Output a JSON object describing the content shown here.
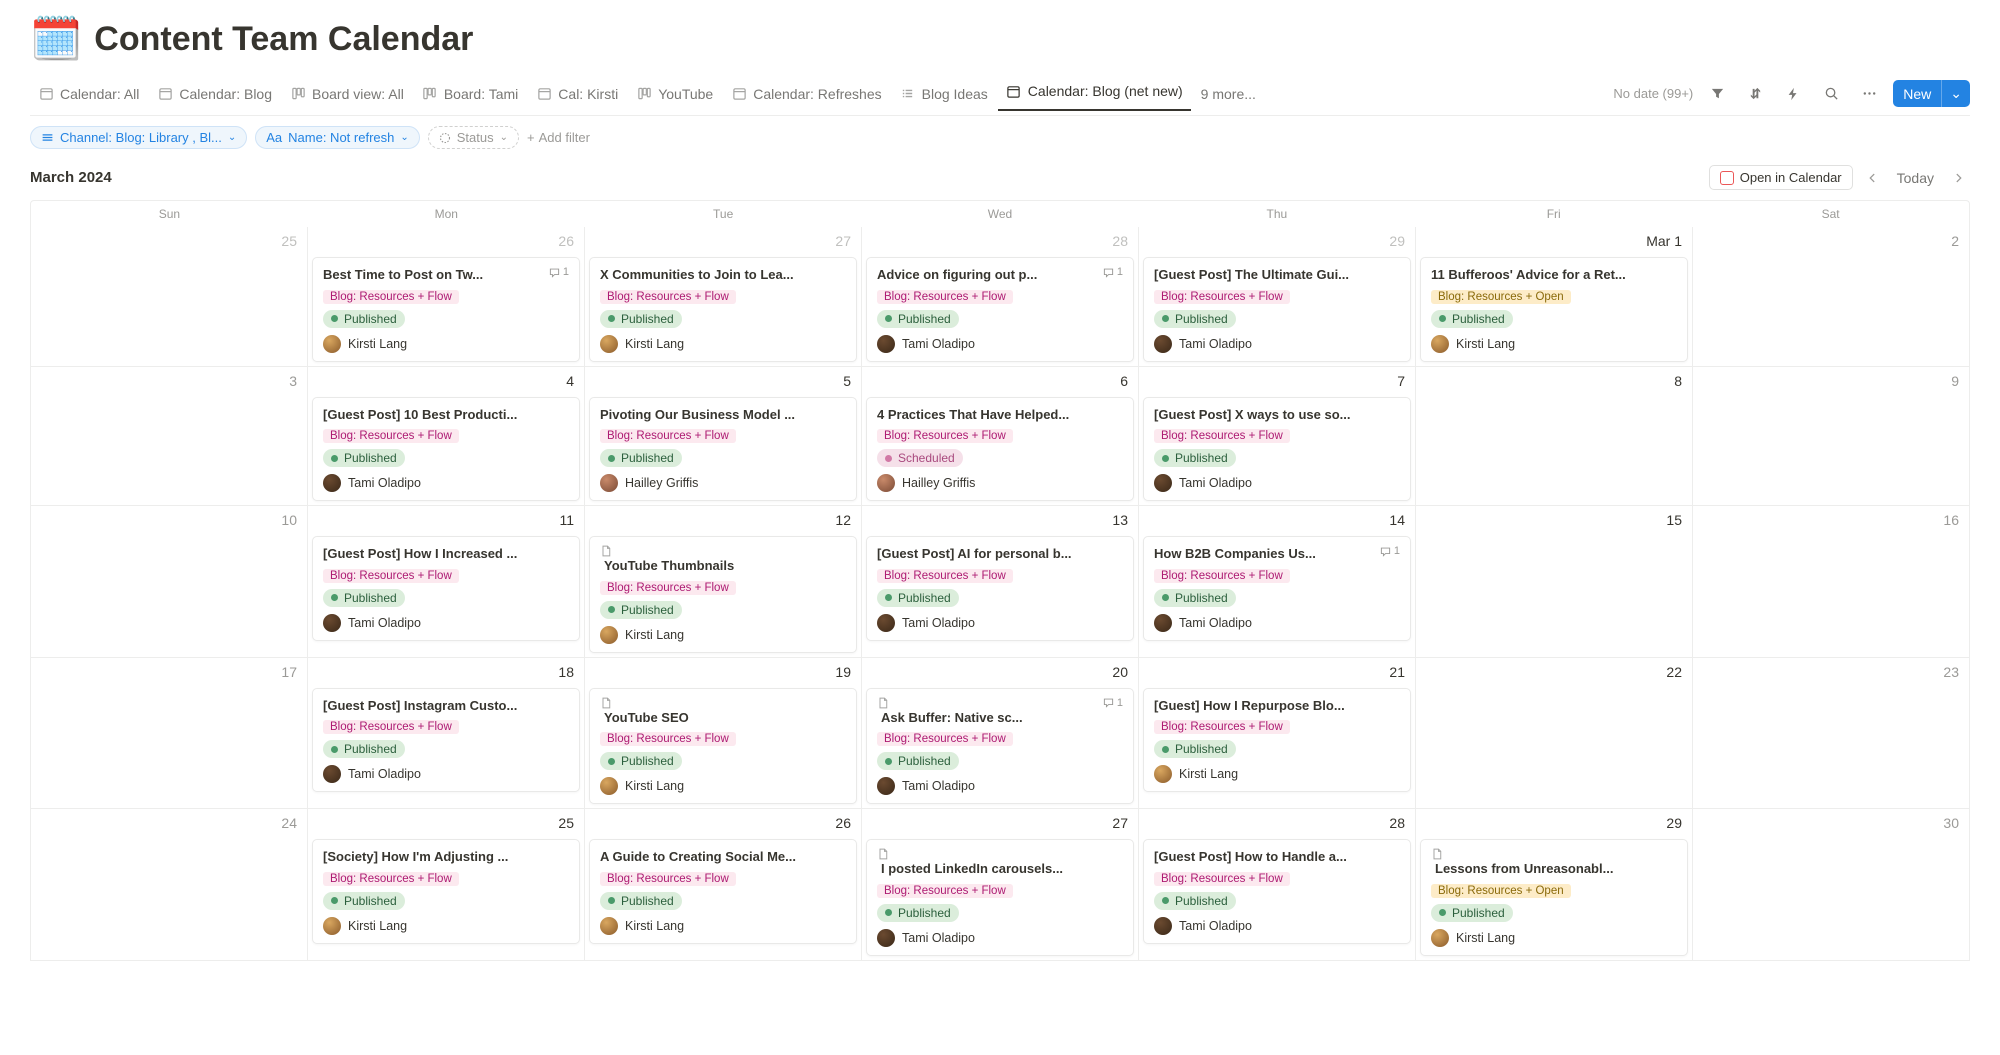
{
  "header": {
    "icon": "📅",
    "title": "Content Team Calendar"
  },
  "tabs": [
    {
      "label": "Calendar: All",
      "icon": "calendar"
    },
    {
      "label": "Calendar: Blog",
      "icon": "calendar"
    },
    {
      "label": "Board view: All",
      "icon": "board"
    },
    {
      "label": "Board: Tami",
      "icon": "board"
    },
    {
      "label": "Cal: Kirsti",
      "icon": "calendar"
    },
    {
      "label": "YouTube",
      "icon": "board"
    },
    {
      "label": "Calendar: Refreshes",
      "icon": "calendar"
    },
    {
      "label": "Blog Ideas",
      "icon": "list"
    },
    {
      "label": "Calendar: Blog (net new)",
      "icon": "calendar",
      "active": true
    }
  ],
  "more_tabs": "9 more...",
  "no_date": "No date (99+)",
  "new_label": "New",
  "filters": {
    "f1": "Channel: Blog: Library , Bl...",
    "f2": "Name: Not refresh",
    "f2_prefix": "Aa",
    "f3": "Status",
    "add": "Add filter"
  },
  "month": "March 2024",
  "open_cal": "Open in Calendar",
  "today": "Today",
  "dow": [
    "Sun",
    "Mon",
    "Tue",
    "Wed",
    "Thu",
    "Fri",
    "Sat"
  ],
  "tags": {
    "flow": "Blog: Resources + Flow",
    "open": "Blog: Resources + Open"
  },
  "statuses": {
    "published": "Published",
    "scheduled": "Scheduled"
  },
  "authors": {
    "kirsti": {
      "name": "Kirsti Lang",
      "color1": "#d9a760",
      "color2": "#8a5a2a"
    },
    "tami": {
      "name": "Tami Oladipo",
      "color1": "#6b4a30",
      "color2": "#3a2818"
    },
    "hailley": {
      "name": "Hailley Griffis",
      "color1": "#c98a6a",
      "color2": "#7a4a35"
    }
  },
  "weeks": [
    {
      "days": [
        {
          "num": "25",
          "outside": true
        },
        {
          "num": "26",
          "outside": true,
          "cards": [
            {
              "title": "Best Time to Post on Tw...",
              "tag": "flow",
              "status": "published",
              "author": "kirsti",
              "comments": "1"
            }
          ]
        },
        {
          "num": "27",
          "outside": true,
          "cards": [
            {
              "title": "X Communities to Join to Lea...",
              "tag": "flow",
              "status": "published",
              "author": "kirsti"
            }
          ]
        },
        {
          "num": "28",
          "outside": true,
          "cards": [
            {
              "title": "Advice on figuring out p...",
              "tag": "flow",
              "status": "published",
              "author": "tami",
              "comments": "1"
            }
          ]
        },
        {
          "num": "29",
          "outside": true,
          "cards": [
            {
              "title": "[Guest Post] The Ultimate Gui...",
              "tag": "flow",
              "status": "published",
              "author": "tami"
            }
          ]
        },
        {
          "num": "Mar 1",
          "first": true,
          "cards": [
            {
              "title": "11 Bufferoos' Advice for a Ret...",
              "tag": "open",
              "status": "published",
              "author": "kirsti"
            }
          ]
        },
        {
          "num": "2"
        }
      ]
    },
    {
      "days": [
        {
          "num": "3"
        },
        {
          "num": "4",
          "cards": [
            {
              "title": "[Guest Post] 10 Best Producti...",
              "tag": "flow",
              "status": "published",
              "author": "tami"
            }
          ]
        },
        {
          "num": "5",
          "cards": [
            {
              "title": "Pivoting Our Business Model ...",
              "tag": "flow",
              "status": "published",
              "author": "hailley"
            }
          ]
        },
        {
          "num": "6",
          "cards": [
            {
              "title": "4 Practices That Have Helped...",
              "tag": "flow",
              "status": "scheduled",
              "author": "hailley"
            }
          ]
        },
        {
          "num": "7",
          "cards": [
            {
              "title": "[Guest Post] X ways to use so...",
              "tag": "flow",
              "status": "published",
              "author": "tami"
            }
          ]
        },
        {
          "num": "8"
        },
        {
          "num": "9"
        }
      ]
    },
    {
      "days": [
        {
          "num": "10"
        },
        {
          "num": "11",
          "cards": [
            {
              "title": "[Guest Post] How I Increased ...",
              "tag": "flow",
              "status": "published",
              "author": "tami"
            }
          ]
        },
        {
          "num": "12",
          "cards": [
            {
              "title": "YouTube Thumbnails",
              "doc": true,
              "tag": "flow",
              "status": "published",
              "author": "kirsti"
            }
          ]
        },
        {
          "num": "13",
          "cards": [
            {
              "title": "[Guest Post] AI for personal b...",
              "tag": "flow",
              "status": "published",
              "author": "tami"
            }
          ]
        },
        {
          "num": "14",
          "cards": [
            {
              "title": "How B2B Companies Us...",
              "tag": "flow",
              "status": "published",
              "author": "tami",
              "comments": "1"
            }
          ]
        },
        {
          "num": "15"
        },
        {
          "num": "16"
        }
      ]
    },
    {
      "days": [
        {
          "num": "17"
        },
        {
          "num": "18",
          "cards": [
            {
              "title": "[Guest Post] Instagram Custo...",
              "tag": "flow",
              "status": "published",
              "author": "tami"
            }
          ]
        },
        {
          "num": "19",
          "cards": [
            {
              "title": "YouTube SEO",
              "doc": true,
              "tag": "flow",
              "status": "published",
              "author": "kirsti"
            }
          ]
        },
        {
          "num": "20",
          "cards": [
            {
              "title": "Ask Buffer: Native sc...",
              "doc": true,
              "tag": "flow",
              "status": "published",
              "author": "tami",
              "comments": "1"
            }
          ]
        },
        {
          "num": "21",
          "cards": [
            {
              "title": "[Guest] How I Repurpose Blo...",
              "tag": "flow",
              "status": "published",
              "author": "kirsti"
            }
          ]
        },
        {
          "num": "22"
        },
        {
          "num": "23"
        }
      ]
    },
    {
      "days": [
        {
          "num": "24"
        },
        {
          "num": "25",
          "cards": [
            {
              "title": "[Society] How I'm Adjusting ...",
              "tag": "flow",
              "status": "published",
              "author": "kirsti"
            }
          ]
        },
        {
          "num": "26",
          "cards": [
            {
              "title": "A Guide to Creating Social Me...",
              "tag": "flow",
              "status": "published",
              "author": "kirsti"
            }
          ]
        },
        {
          "num": "27",
          "cards": [
            {
              "title": "I posted LinkedIn carousels...",
              "doc": true,
              "tag": "flow",
              "status": "published",
              "author": "tami"
            }
          ]
        },
        {
          "num": "28",
          "cards": [
            {
              "title": "[Guest Post] How to Handle a...",
              "tag": "flow",
              "status": "published",
              "author": "tami"
            }
          ]
        },
        {
          "num": "29",
          "cards": [
            {
              "title": "Lessons from Unreasonabl...",
              "doc": true,
              "tag": "open",
              "status": "published",
              "author": "kirsti"
            }
          ]
        },
        {
          "num": "30"
        }
      ]
    }
  ]
}
